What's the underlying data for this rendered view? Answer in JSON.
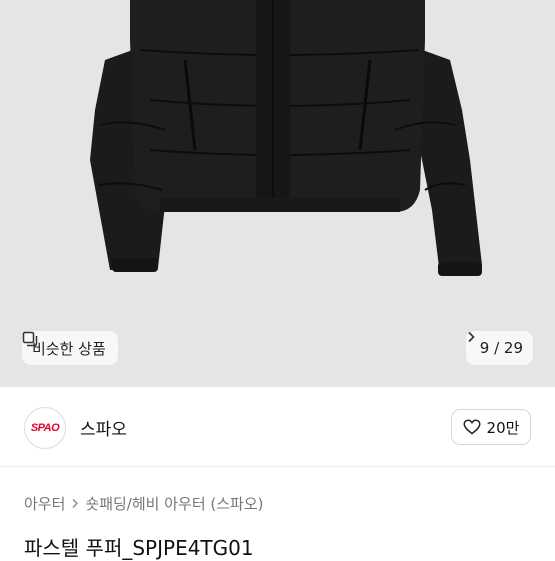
{
  "gallery": {
    "similar_label": "비슷한 상품",
    "counter": "9 / 29"
  },
  "brand": {
    "logo_text": "SPAO",
    "name": "스파오",
    "likes": "20만"
  },
  "breadcrumb": {
    "first": "아우터",
    "second": "숏패딩/헤비 아우터 (스파오)"
  },
  "product": {
    "title": "파스텔 푸퍼_SPJPE4TG01"
  },
  "colors": {
    "brand_red": "#e4002b",
    "photo_bg": "#e5e5e7"
  }
}
